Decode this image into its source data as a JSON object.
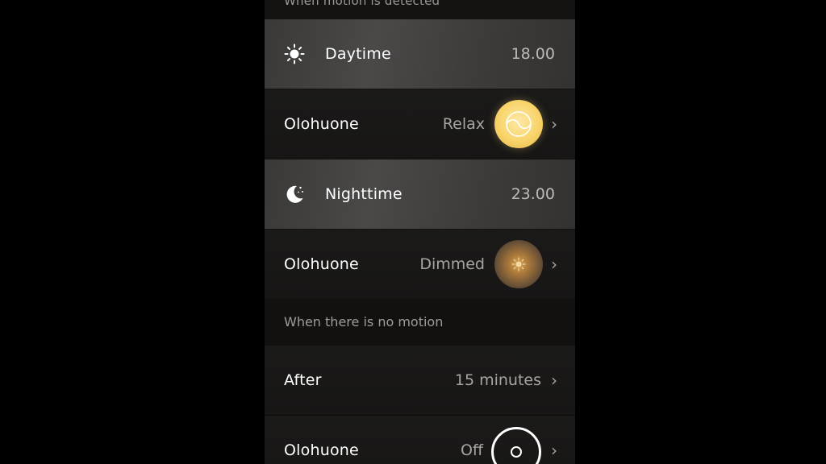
{
  "motion_section": {
    "label": "When motion is detected"
  },
  "daytime": {
    "label": "Daytime",
    "time": "18.00",
    "icon": "sun-icon"
  },
  "daytime_room": {
    "room": "Olohuone",
    "scene": "Relax",
    "chevron": "›",
    "bulb_color": "#f8d46b"
  },
  "nighttime": {
    "label": "Nighttime",
    "time": "23.00",
    "icon": "moon-icon"
  },
  "nighttime_room": {
    "room": "Olohuone",
    "scene": "Dimmed",
    "chevron": "›",
    "bulb_color": "#a9773a"
  },
  "no_motion_section": {
    "label": "When there is no motion"
  },
  "after": {
    "label": "After",
    "value": "15 minutes",
    "chevron": "›"
  },
  "after_room": {
    "room": "Olohuone",
    "scene": "Off",
    "chevron": "›"
  }
}
